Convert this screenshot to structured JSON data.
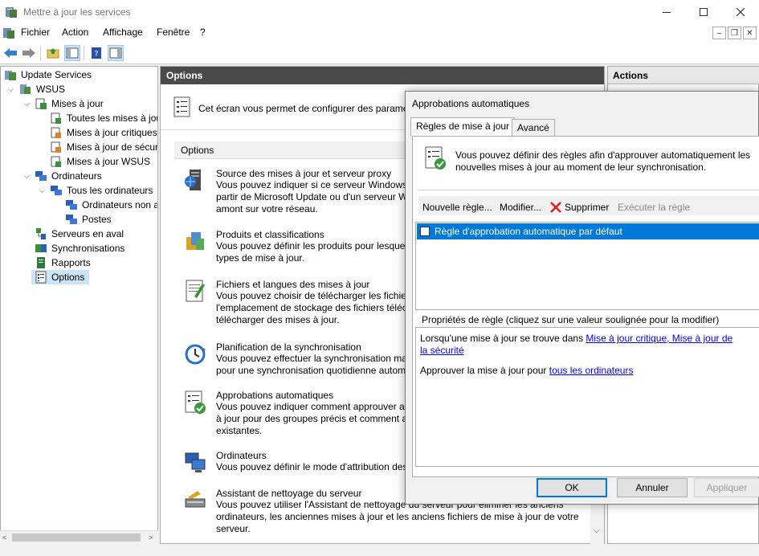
{
  "window": {
    "title": "Mettre à jour les services"
  },
  "menu": [
    "Fichier",
    "Action",
    "Affichage",
    "Fenêtre",
    "?"
  ],
  "tree": {
    "root": "Update Services",
    "server": "WSUS",
    "updates": "Mises à jour",
    "all_updates": "Toutes les mises à jour",
    "critical_updates": "Mises à jour critiques",
    "security_updates": "Mises à jour de sécurité",
    "wsus_updates": "Mises à jour WSUS",
    "computers": "Ordinateurs",
    "all_computers": "Tous les ordinateurs",
    "unassigned": "Ordinateurs non attribués",
    "workstations": "Postes",
    "downstream": "Serveurs en aval",
    "syncs": "Synchronisations",
    "reports": "Rapports",
    "options": "Options"
  },
  "center": {
    "header": "Options",
    "intro": "Cet écran vous permet de configurer des paramètres",
    "section_title": "Options",
    "options": [
      {
        "title": "Source des mises à jour et serveur proxy",
        "desc": [
          "Vous pouvez indiquer si ce serveur Windows",
          "partir de Microsoft Update ou d'un serveur W",
          "amont sur votre réseau."
        ]
      },
      {
        "title": "Produits et classifications",
        "desc": [
          "Vous pouvez définir les produits pour lesquel",
          "types de mise à jour."
        ]
      },
      {
        "title": "Fichiers et langues des mises à jour",
        "desc": [
          "Vous pouvez choisir de télécharger les fichier",
          "l'emplacement de stockage des fichiers téléc",
          "télécharger des mises à jour."
        ]
      },
      {
        "title": "Planification de la synchronisation",
        "desc": [
          "Vous pouvez effectuer la synchronisation ma",
          "pour une synchronisation quotidienne autom"
        ]
      },
      {
        "title": "Approbations automatiques",
        "desc": [
          "Vous pouvez indiquer comment approuver au",
          "à jour pour des groupes précis et comment a",
          "existantes."
        ]
      },
      {
        "title": "Ordinateurs",
        "desc": [
          "Vous pouvez définir le mode d'attribution des"
        ]
      },
      {
        "title": "Assistant de nettoyage du serveur",
        "desc": [
          "Vous pouvez utiliser l'Assistant de nettoyage du serveur pour éliminer les anciens",
          "ordinateurs, les anciennes mises à jour et les anciens fichiers de mise à jour de votre",
          "serveur."
        ]
      }
    ]
  },
  "actions": {
    "header": "Actions"
  },
  "dialog": {
    "title": "Approbations automatiques",
    "tabs": [
      "Règles de mise à jour",
      "Avancé"
    ],
    "intro_line1": "Vous pouvez définir des règles afin d'approuver automatiquement les",
    "intro_line2": "nouvelles mises à jour au moment de leur synchronisation.",
    "toolbar": {
      "new": "Nouvelle règle...",
      "edit": "Modifier...",
      "delete": "Supprimer",
      "run": "Exécuter la règle"
    },
    "rules": [
      {
        "label": "Règle d'approbation automatique par défaut",
        "checked": false
      }
    ],
    "props_label": "Propriétés de règle (cliquez sur une valeur soulignée pour la modifier)",
    "prop1_prefix": "Lorsqu'une mise à jour se trouve dans ",
    "prop1_link_a": "Mise à jour critique, Mise à jour de",
    "prop1_link_b": "la sécurité",
    "prop2_prefix": "Approuver la mise à jour pour ",
    "prop2_link": "tous les ordinateurs",
    "buttons": {
      "ok": "OK",
      "cancel": "Annuler",
      "apply": "Appliquer"
    }
  },
  "colors": {
    "selection": "#0078d7",
    "header_dark": "#4a4a4a",
    "link": "#0000ee"
  }
}
